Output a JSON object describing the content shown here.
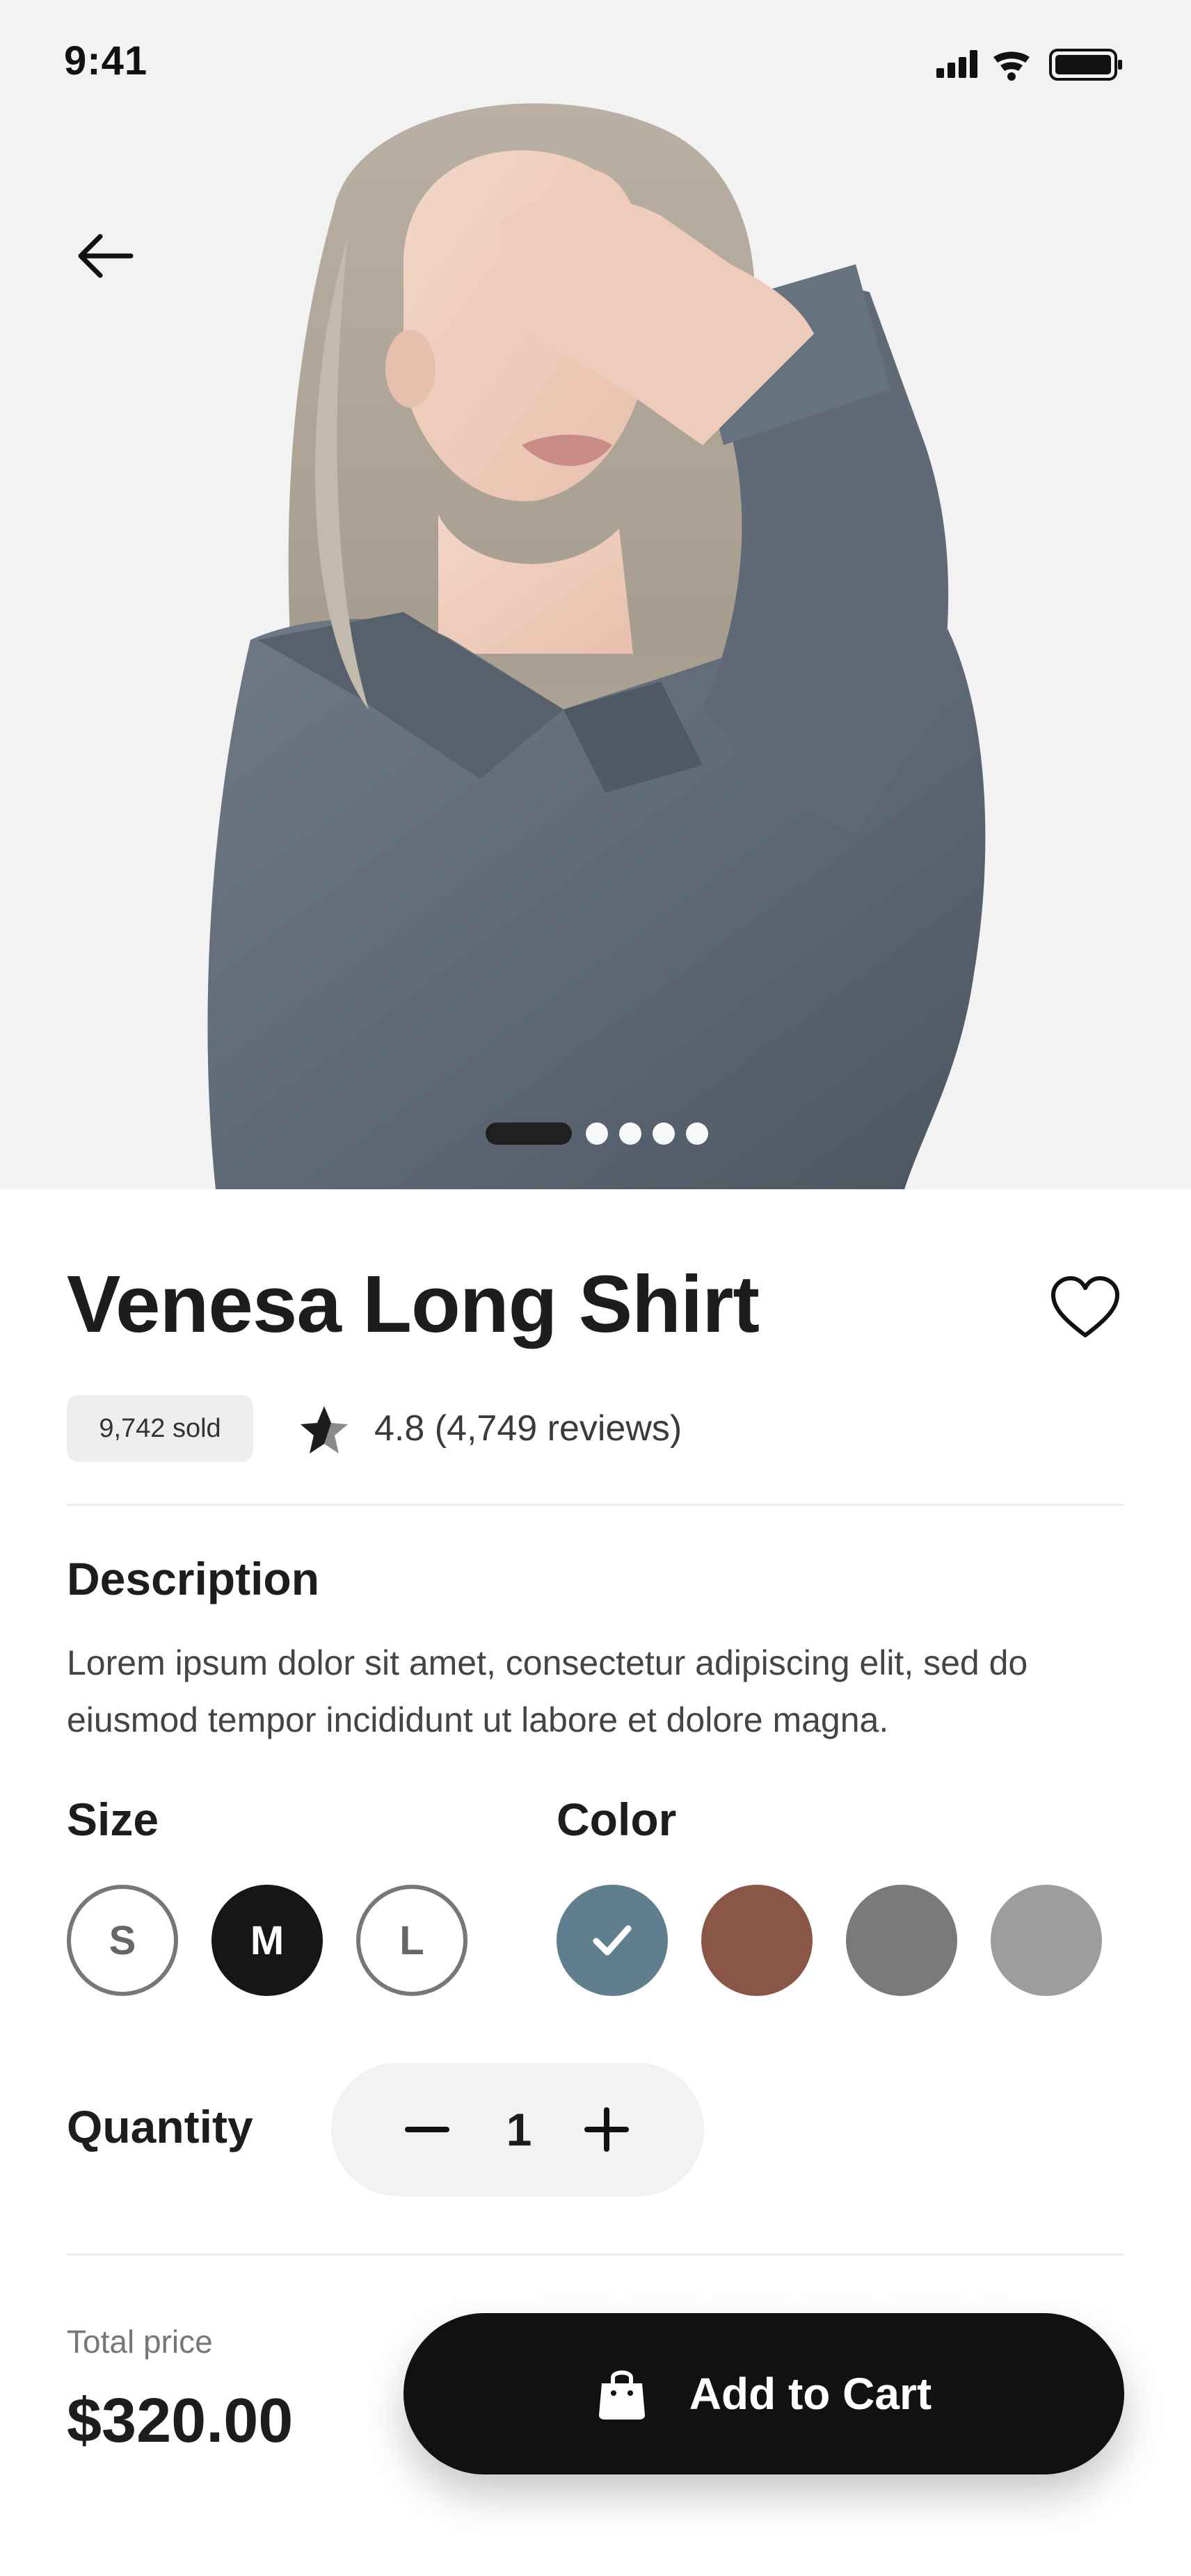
{
  "status_bar": {
    "time": "9:41"
  },
  "product": {
    "title": "Venesa Long Shirt",
    "sold": "9,742 sold",
    "rating": "4.8 (4,749 reviews)"
  },
  "description": {
    "heading": "Description",
    "text": "Lorem ipsum dolor sit amet, consectetur adipiscing elit, sed do eiusmod tempor incididunt ut labore et dolore magna."
  },
  "size": {
    "heading": "Size",
    "options": [
      "S",
      "M",
      "L"
    ],
    "selected": "M"
  },
  "color": {
    "heading": "Color",
    "options": [
      "#5f7f8f",
      "#8a5746",
      "#7a7a7a",
      "#9d9d9d"
    ],
    "selected_index": 0
  },
  "quantity": {
    "label": "Quantity",
    "value": "1"
  },
  "footer": {
    "total_label": "Total price",
    "total_value": "$320.00",
    "cart_label": "Add to Cart"
  },
  "carousel": {
    "total": 5,
    "active_index": 0
  },
  "colors": {
    "accent": "#111111",
    "background": "#f2f2f2"
  },
  "icons": [
    "back-arrow-icon",
    "heart-icon",
    "star-icon",
    "minus-icon",
    "plus-icon",
    "shopping-bag-icon",
    "check-icon",
    "signal-icon",
    "wifi-icon",
    "battery-icon"
  ]
}
